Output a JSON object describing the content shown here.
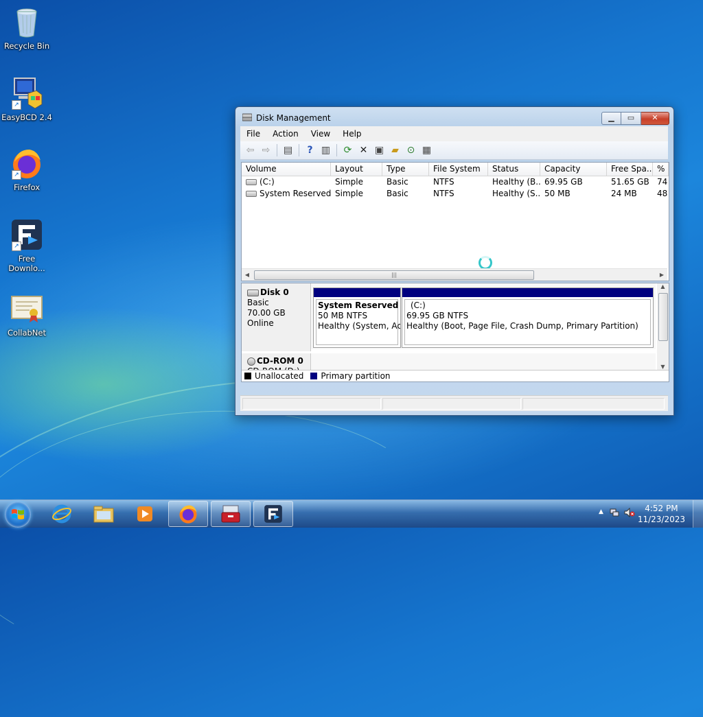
{
  "desktop": {
    "icons": [
      {
        "label": "Recycle Bin"
      },
      {
        "label": "EasyBCD 2.4"
      },
      {
        "label": "Firefox"
      },
      {
        "label": "Free Downlo..."
      },
      {
        "label": "CollabNet"
      }
    ]
  },
  "window": {
    "title": "Disk Management",
    "menu": [
      "File",
      "Action",
      "View",
      "Help"
    ],
    "columns": [
      "Volume",
      "Layout",
      "Type",
      "File System",
      "Status",
      "Capacity",
      "Free Spa...",
      "% F"
    ],
    "volumes": [
      {
        "volume": "(C:)",
        "layout": "Simple",
        "type": "Basic",
        "fs": "NTFS",
        "status": "Healthy (B...",
        "capacity": "69.95 GB",
        "free": "51.65 GB",
        "pct": "74"
      },
      {
        "volume": "System Reserved",
        "layout": "Simple",
        "type": "Basic",
        "fs": "NTFS",
        "status": "Healthy (S...",
        "capacity": "50 MB",
        "free": "24 MB",
        "pct": "48"
      }
    ],
    "disks": [
      {
        "name": "Disk 0",
        "type": "Basic",
        "size": "70.00 GB",
        "state": "Online"
      },
      {
        "name": "CD-ROM 0",
        "type": "CD-ROM (D:)"
      }
    ],
    "partitions": [
      {
        "name": "System Reserved",
        "size": "50 MB NTFS",
        "status": "Healthy (System, Acti"
      },
      {
        "name": "(C:)",
        "size": "69.95 GB NTFS",
        "status": "Healthy (Boot, Page File, Crash Dump, Primary Partition)"
      }
    ],
    "legend": {
      "unallocated": "Unallocated",
      "primary": "Primary partition"
    },
    "colors": {
      "primary": "#00007f",
      "unallocated": "#000000"
    }
  },
  "taskbar": {
    "time": "4:52 PM",
    "date": "11/23/2023"
  }
}
